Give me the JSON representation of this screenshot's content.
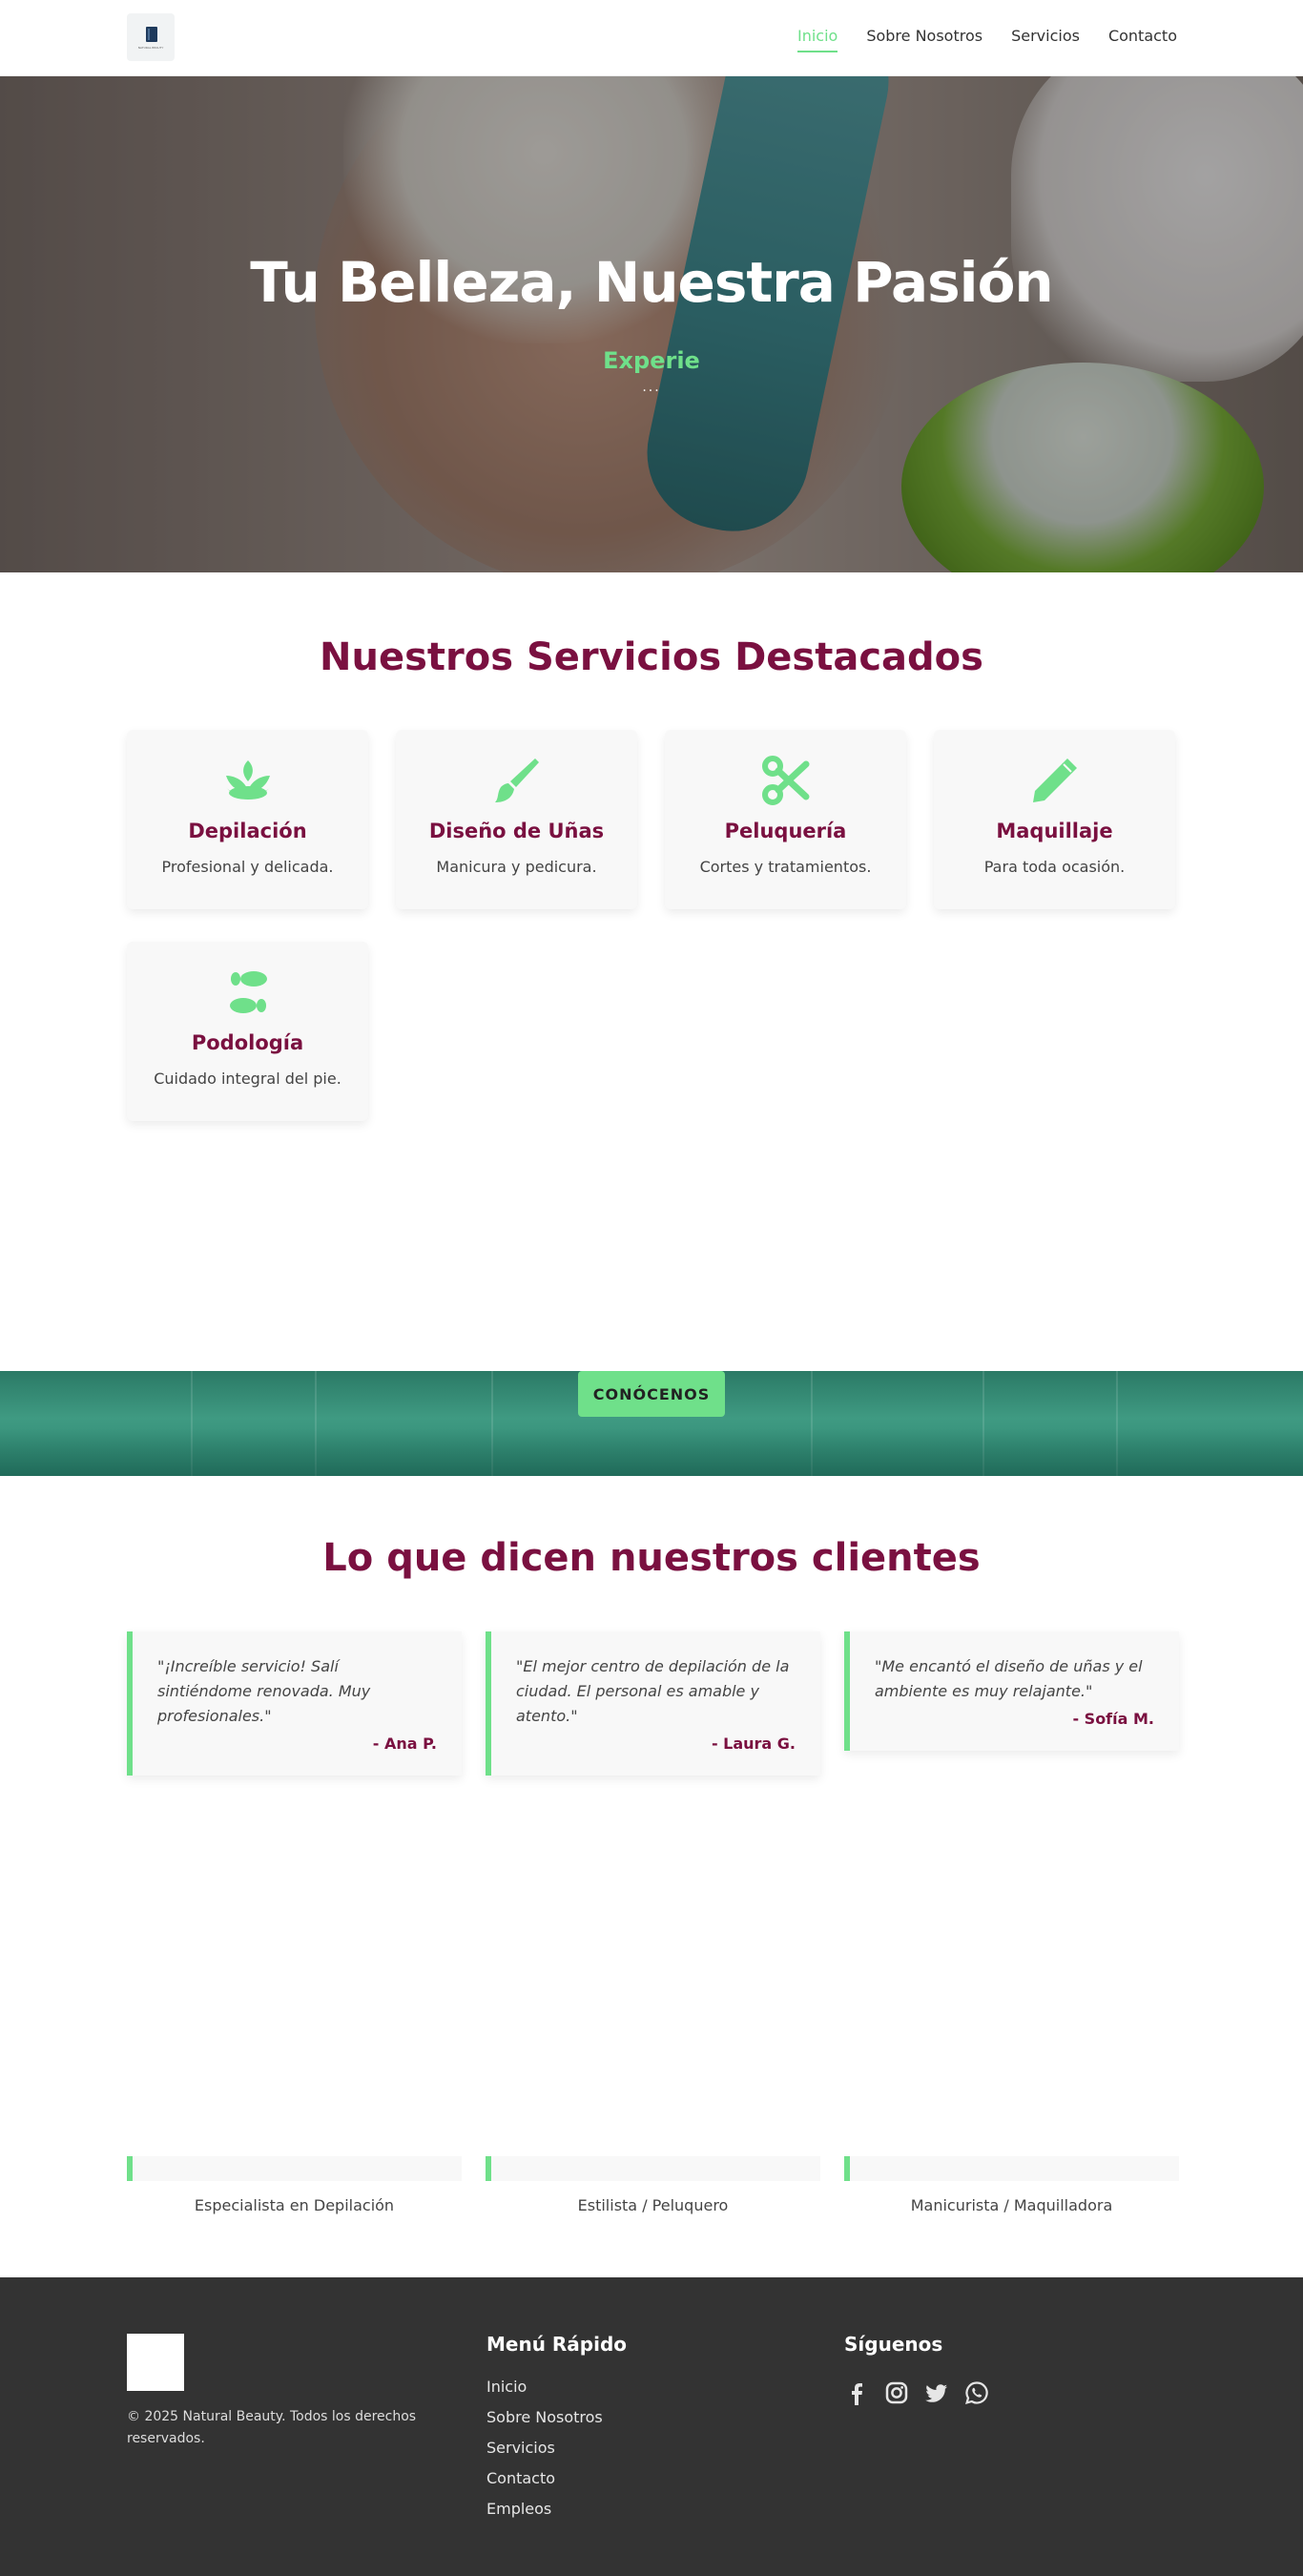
{
  "header": {
    "logo_text": "NATURAL BEAUTY",
    "nav": [
      {
        "label": "Inicio",
        "active": true
      },
      {
        "label": "Sobre Nosotros",
        "active": false
      },
      {
        "label": "Servicios",
        "active": false
      },
      {
        "label": "Contacto",
        "active": false
      }
    ]
  },
  "hero": {
    "title": "Tu Belleza, Nuestra Pasión",
    "subtitle": "Experie",
    "dots": "..."
  },
  "services": {
    "title": "Nuestros Servicios Destacados",
    "items": [
      {
        "icon": "spa-icon",
        "name": "Depilación",
        "desc": "Profesional y delicada."
      },
      {
        "icon": "paint-brush-icon",
        "name": "Diseño de Uñas",
        "desc": "Manicura y pedicura."
      },
      {
        "icon": "scissors-icon",
        "name": "Peluquería",
        "desc": "Cortes y tratamientos."
      },
      {
        "icon": "pencil-icon",
        "name": "Maquillaje",
        "desc": "Para toda ocasión."
      },
      {
        "icon": "shoe-prints-icon",
        "name": "Podología",
        "desc": "Cuidado integral del pie."
      }
    ]
  },
  "band": {
    "button_label": "CONÓCENOS"
  },
  "testimonials": {
    "title": "Lo que dicen nuestros clientes",
    "items": [
      {
        "quote": "\"¡Increíble servicio! Salí sintiéndome renovada. Muy profesionales.\"",
        "author": "- Ana P."
      },
      {
        "quote": "\"El mejor centro de depilación de la ciudad. El personal es amable y atento.\"",
        "author": "- Laura G."
      },
      {
        "quote": "\"Me encantó el diseño de uñas y el ambiente es muy relajante.\"",
        "author": "- Sofía M."
      }
    ]
  },
  "team": {
    "roles": [
      "Especialista en Depilación",
      "Estilista / Peluquero",
      "Manicurista / Maquilladora"
    ]
  },
  "footer": {
    "copyright": "© 2025 Natural Beauty. Todos los derechos reservados.",
    "menu_title": "Menú Rápido",
    "menu": [
      "Inicio",
      "Sobre Nosotros",
      "Servicios",
      "Contacto",
      "Empleos"
    ],
    "social_title": "Síguenos",
    "social": [
      "facebook-icon",
      "instagram-icon",
      "twitter-icon",
      "whatsapp-icon"
    ]
  },
  "colors": {
    "accent_green": "#6fe08a",
    "brand_wine": "#7a1040",
    "footer_bg": "#333333",
    "band_teal": "#3f9a82"
  }
}
